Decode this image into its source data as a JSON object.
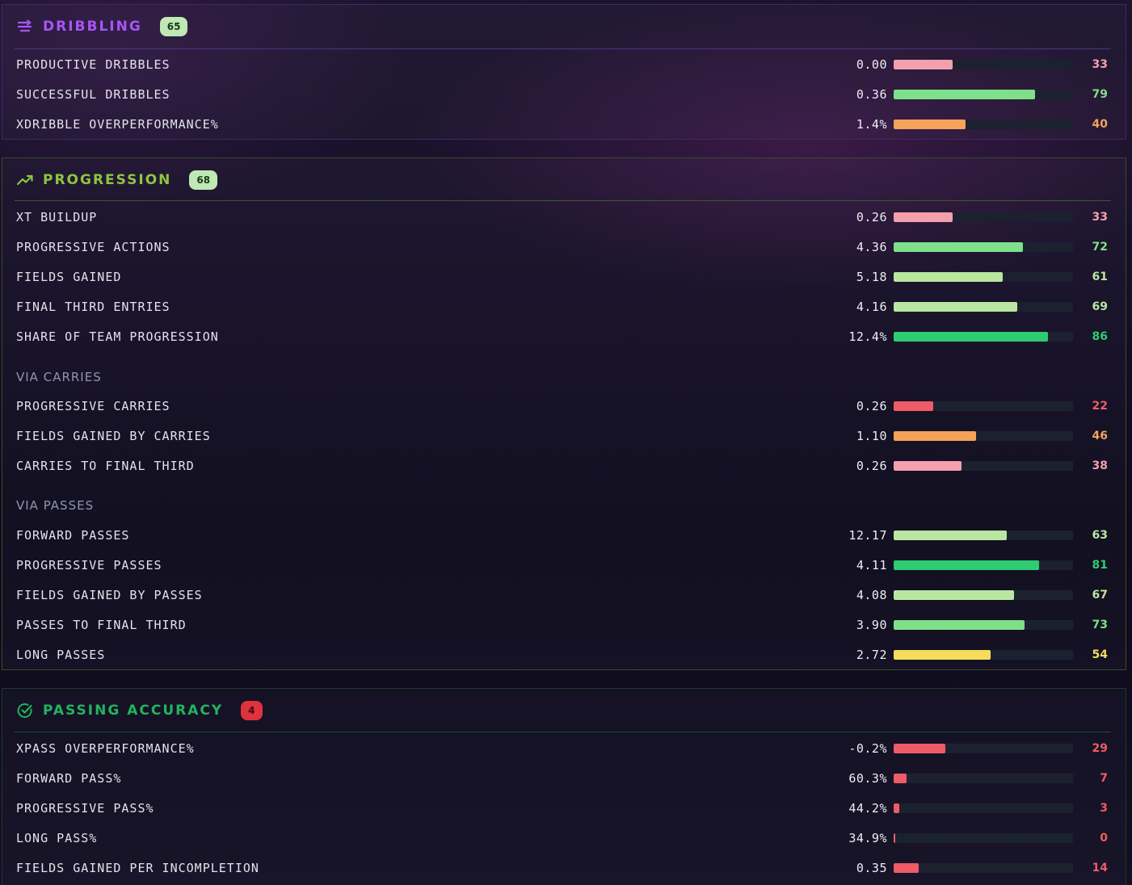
{
  "colors": {
    "dribbling_accent": "#a855f7",
    "progression_accent": "#8dc63f",
    "passing_accent": "#22b35e",
    "tier_elite": "#2ecc71",
    "tier_good": "#7ee08a",
    "tier_above": "#b9e6a0",
    "tier_average": "#f5dc5a",
    "tier_below": "#f5a25a",
    "tier_poor": "#f4a0ac",
    "tier_bad": "#ef5b66"
  },
  "sections": [
    {
      "id": "dribbling",
      "icon": "arrows-icon",
      "title": "DRIBBLING",
      "score": "65",
      "rows": [
        {
          "label": "PRODUCTIVE DRIBBLES",
          "value": "0.00",
          "percentile": "33"
        },
        {
          "label": "SUCCESSFUL DRIBBLES",
          "value": "0.36",
          "percentile": "79"
        },
        {
          "label": "XDRIBBLE OVERPERFORMANCE%",
          "value": "1.4%",
          "percentile": "40"
        }
      ]
    },
    {
      "id": "progression",
      "icon": "trending-up-icon",
      "title": "PROGRESSION",
      "score": "68",
      "rows": [
        {
          "label": "XT BUILDUP",
          "value": "0.26",
          "percentile": "33"
        },
        {
          "label": "PROGRESSIVE ACTIONS",
          "value": "4.36",
          "percentile": "72"
        },
        {
          "label": "FIELDS GAINED",
          "value": "5.18",
          "percentile": "61"
        },
        {
          "label": "FINAL THIRD ENTRIES",
          "value": "4.16",
          "percentile": "69"
        },
        {
          "label": "SHARE OF TEAM PROGRESSION",
          "value": "12.4%",
          "percentile": "86"
        }
      ],
      "groups": [
        {
          "subhead": "VIA CARRIES",
          "rows": [
            {
              "label": "PROGRESSIVE CARRIES",
              "value": "0.26",
              "percentile": "22"
            },
            {
              "label": "FIELDS GAINED BY CARRIES",
              "value": "1.10",
              "percentile": "46"
            },
            {
              "label": "CARRIES TO FINAL THIRD",
              "value": "0.26",
              "percentile": "38"
            }
          ]
        },
        {
          "subhead": "VIA PASSES",
          "rows": [
            {
              "label": "FORWARD PASSES",
              "value": "12.17",
              "percentile": "63"
            },
            {
              "label": "PROGRESSIVE PASSES",
              "value": "4.11",
              "percentile": "81"
            },
            {
              "label": "FIELDS GAINED BY PASSES",
              "value": "4.08",
              "percentile": "67"
            },
            {
              "label": "PASSES TO FINAL THIRD",
              "value": "3.90",
              "percentile": "73"
            },
            {
              "label": "LONG PASSES",
              "value": "2.72",
              "percentile": "54"
            }
          ]
        }
      ]
    },
    {
      "id": "passing",
      "icon": "check-circle-icon",
      "title": "PASSING ACCURACY",
      "score": "4",
      "rows": [
        {
          "label": "XPASS OVERPERFORMANCE%",
          "value": "-0.2%",
          "percentile": "29"
        },
        {
          "label": "FORWARD PASS%",
          "value": "60.3%",
          "percentile": "7"
        },
        {
          "label": "PROGRESSIVE PASS%",
          "value": "44.2%",
          "percentile": "3"
        },
        {
          "label": "LONG PASS%",
          "value": "34.9%",
          "percentile": "0"
        },
        {
          "label": "FIELDS GAINED PER INCOMPLETION",
          "value": "0.35",
          "percentile": "14"
        }
      ]
    }
  ]
}
